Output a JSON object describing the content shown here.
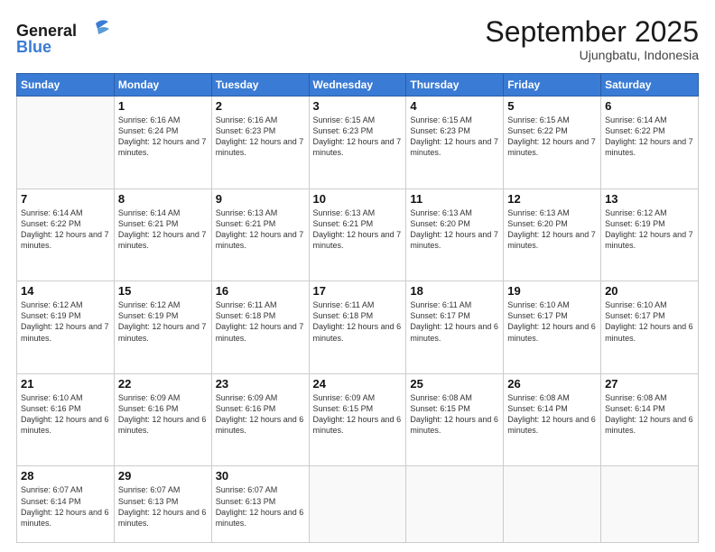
{
  "logo": {
    "line1": "General",
    "line2": "Blue"
  },
  "title": "September 2025",
  "subtitle": "Ujungbatu, Indonesia",
  "days_of_week": [
    "Sunday",
    "Monday",
    "Tuesday",
    "Wednesday",
    "Thursday",
    "Friday",
    "Saturday"
  ],
  "weeks": [
    [
      {
        "day": "",
        "info": ""
      },
      {
        "day": "1",
        "info": "Sunrise: 6:16 AM\nSunset: 6:24 PM\nDaylight: 12 hours\nand 7 minutes."
      },
      {
        "day": "2",
        "info": "Sunrise: 6:16 AM\nSunset: 6:23 PM\nDaylight: 12 hours\nand 7 minutes."
      },
      {
        "day": "3",
        "info": "Sunrise: 6:15 AM\nSunset: 6:23 PM\nDaylight: 12 hours\nand 7 minutes."
      },
      {
        "day": "4",
        "info": "Sunrise: 6:15 AM\nSunset: 6:23 PM\nDaylight: 12 hours\nand 7 minutes."
      },
      {
        "day": "5",
        "info": "Sunrise: 6:15 AM\nSunset: 6:22 PM\nDaylight: 12 hours\nand 7 minutes."
      },
      {
        "day": "6",
        "info": "Sunrise: 6:14 AM\nSunset: 6:22 PM\nDaylight: 12 hours\nand 7 minutes."
      }
    ],
    [
      {
        "day": "7",
        "info": "Sunrise: 6:14 AM\nSunset: 6:22 PM\nDaylight: 12 hours\nand 7 minutes."
      },
      {
        "day": "8",
        "info": "Sunrise: 6:14 AM\nSunset: 6:21 PM\nDaylight: 12 hours\nand 7 minutes."
      },
      {
        "day": "9",
        "info": "Sunrise: 6:13 AM\nSunset: 6:21 PM\nDaylight: 12 hours\nand 7 minutes."
      },
      {
        "day": "10",
        "info": "Sunrise: 6:13 AM\nSunset: 6:21 PM\nDaylight: 12 hours\nand 7 minutes."
      },
      {
        "day": "11",
        "info": "Sunrise: 6:13 AM\nSunset: 6:20 PM\nDaylight: 12 hours\nand 7 minutes."
      },
      {
        "day": "12",
        "info": "Sunrise: 6:13 AM\nSunset: 6:20 PM\nDaylight: 12 hours\nand 7 minutes."
      },
      {
        "day": "13",
        "info": "Sunrise: 6:12 AM\nSunset: 6:19 PM\nDaylight: 12 hours\nand 7 minutes."
      }
    ],
    [
      {
        "day": "14",
        "info": "Sunrise: 6:12 AM\nSunset: 6:19 PM\nDaylight: 12 hours\nand 7 minutes."
      },
      {
        "day": "15",
        "info": "Sunrise: 6:12 AM\nSunset: 6:19 PM\nDaylight: 12 hours\nand 7 minutes."
      },
      {
        "day": "16",
        "info": "Sunrise: 6:11 AM\nSunset: 6:18 PM\nDaylight: 12 hours\nand 7 minutes."
      },
      {
        "day": "17",
        "info": "Sunrise: 6:11 AM\nSunset: 6:18 PM\nDaylight: 12 hours\nand 6 minutes."
      },
      {
        "day": "18",
        "info": "Sunrise: 6:11 AM\nSunset: 6:17 PM\nDaylight: 12 hours\nand 6 minutes."
      },
      {
        "day": "19",
        "info": "Sunrise: 6:10 AM\nSunset: 6:17 PM\nDaylight: 12 hours\nand 6 minutes."
      },
      {
        "day": "20",
        "info": "Sunrise: 6:10 AM\nSunset: 6:17 PM\nDaylight: 12 hours\nand 6 minutes."
      }
    ],
    [
      {
        "day": "21",
        "info": "Sunrise: 6:10 AM\nSunset: 6:16 PM\nDaylight: 12 hours\nand 6 minutes."
      },
      {
        "day": "22",
        "info": "Sunrise: 6:09 AM\nSunset: 6:16 PM\nDaylight: 12 hours\nand 6 minutes."
      },
      {
        "day": "23",
        "info": "Sunrise: 6:09 AM\nSunset: 6:16 PM\nDaylight: 12 hours\nand 6 minutes."
      },
      {
        "day": "24",
        "info": "Sunrise: 6:09 AM\nSunset: 6:15 PM\nDaylight: 12 hours\nand 6 minutes."
      },
      {
        "day": "25",
        "info": "Sunrise: 6:08 AM\nSunset: 6:15 PM\nDaylight: 12 hours\nand 6 minutes."
      },
      {
        "day": "26",
        "info": "Sunrise: 6:08 AM\nSunset: 6:14 PM\nDaylight: 12 hours\nand 6 minutes."
      },
      {
        "day": "27",
        "info": "Sunrise: 6:08 AM\nSunset: 6:14 PM\nDaylight: 12 hours\nand 6 minutes."
      }
    ],
    [
      {
        "day": "28",
        "info": "Sunrise: 6:07 AM\nSunset: 6:14 PM\nDaylight: 12 hours\nand 6 minutes."
      },
      {
        "day": "29",
        "info": "Sunrise: 6:07 AM\nSunset: 6:13 PM\nDaylight: 12 hours\nand 6 minutes."
      },
      {
        "day": "30",
        "info": "Sunrise: 6:07 AM\nSunset: 6:13 PM\nDaylight: 12 hours\nand 6 minutes."
      },
      {
        "day": "",
        "info": ""
      },
      {
        "day": "",
        "info": ""
      },
      {
        "day": "",
        "info": ""
      },
      {
        "day": "",
        "info": ""
      }
    ]
  ]
}
